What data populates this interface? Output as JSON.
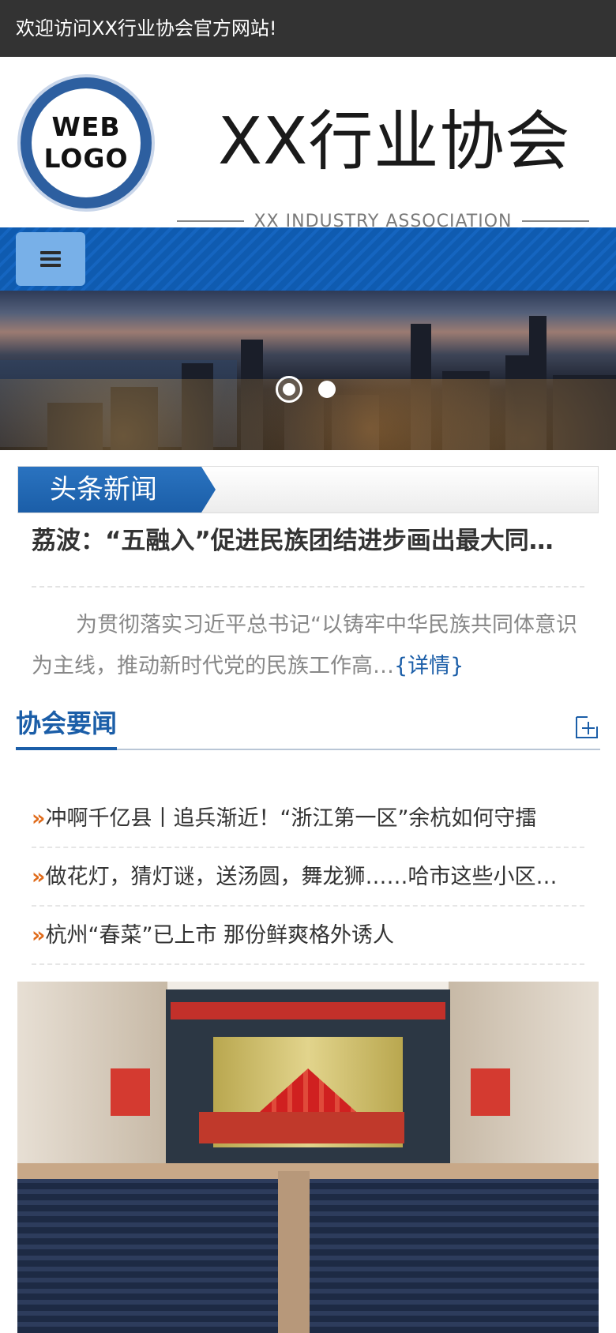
{
  "topbar": {
    "welcome": "欢迎访问XX行业协会官方网站!"
  },
  "header": {
    "logo_line1": "WEB",
    "logo_line2": "LOGO",
    "title": "XX行业协会",
    "subtitle": "XX INDUSTRY ASSOCIATION"
  },
  "nav": {
    "menu_icon": "hamburger-icon"
  },
  "banner": {
    "slides": 2,
    "active_slide": 1
  },
  "headline": {
    "tab": "头条新闻",
    "title": "荔波：“五融入”促进民族团结进步画出最大同…",
    "summary": "为贯彻落实习近平总书记“以铸牢中华民族共同体意识为主线，推动新时代党的民族工作高…",
    "more": "{详情}"
  },
  "association_news": {
    "title": "协会要闻",
    "more_icon": "plus-icon",
    "items": [
      {
        "marker": "»",
        "text": "冲啊千亿县丨追兵渐近！“浙江第一区”余杭如何守擂"
      },
      {
        "marker": "»",
        "text": "做花灯，猜灯谜，送汤圆，舞龙狮……哈市这些小区…"
      },
      {
        "marker": "»",
        "text": "杭州“春菜”已上市 那份鲜爽格外诱人"
      }
    ]
  },
  "colors": {
    "topbar": "#333333",
    "nav": "#1565c0",
    "accent": "#1b5ea8",
    "marker": "#e06b1a"
  }
}
